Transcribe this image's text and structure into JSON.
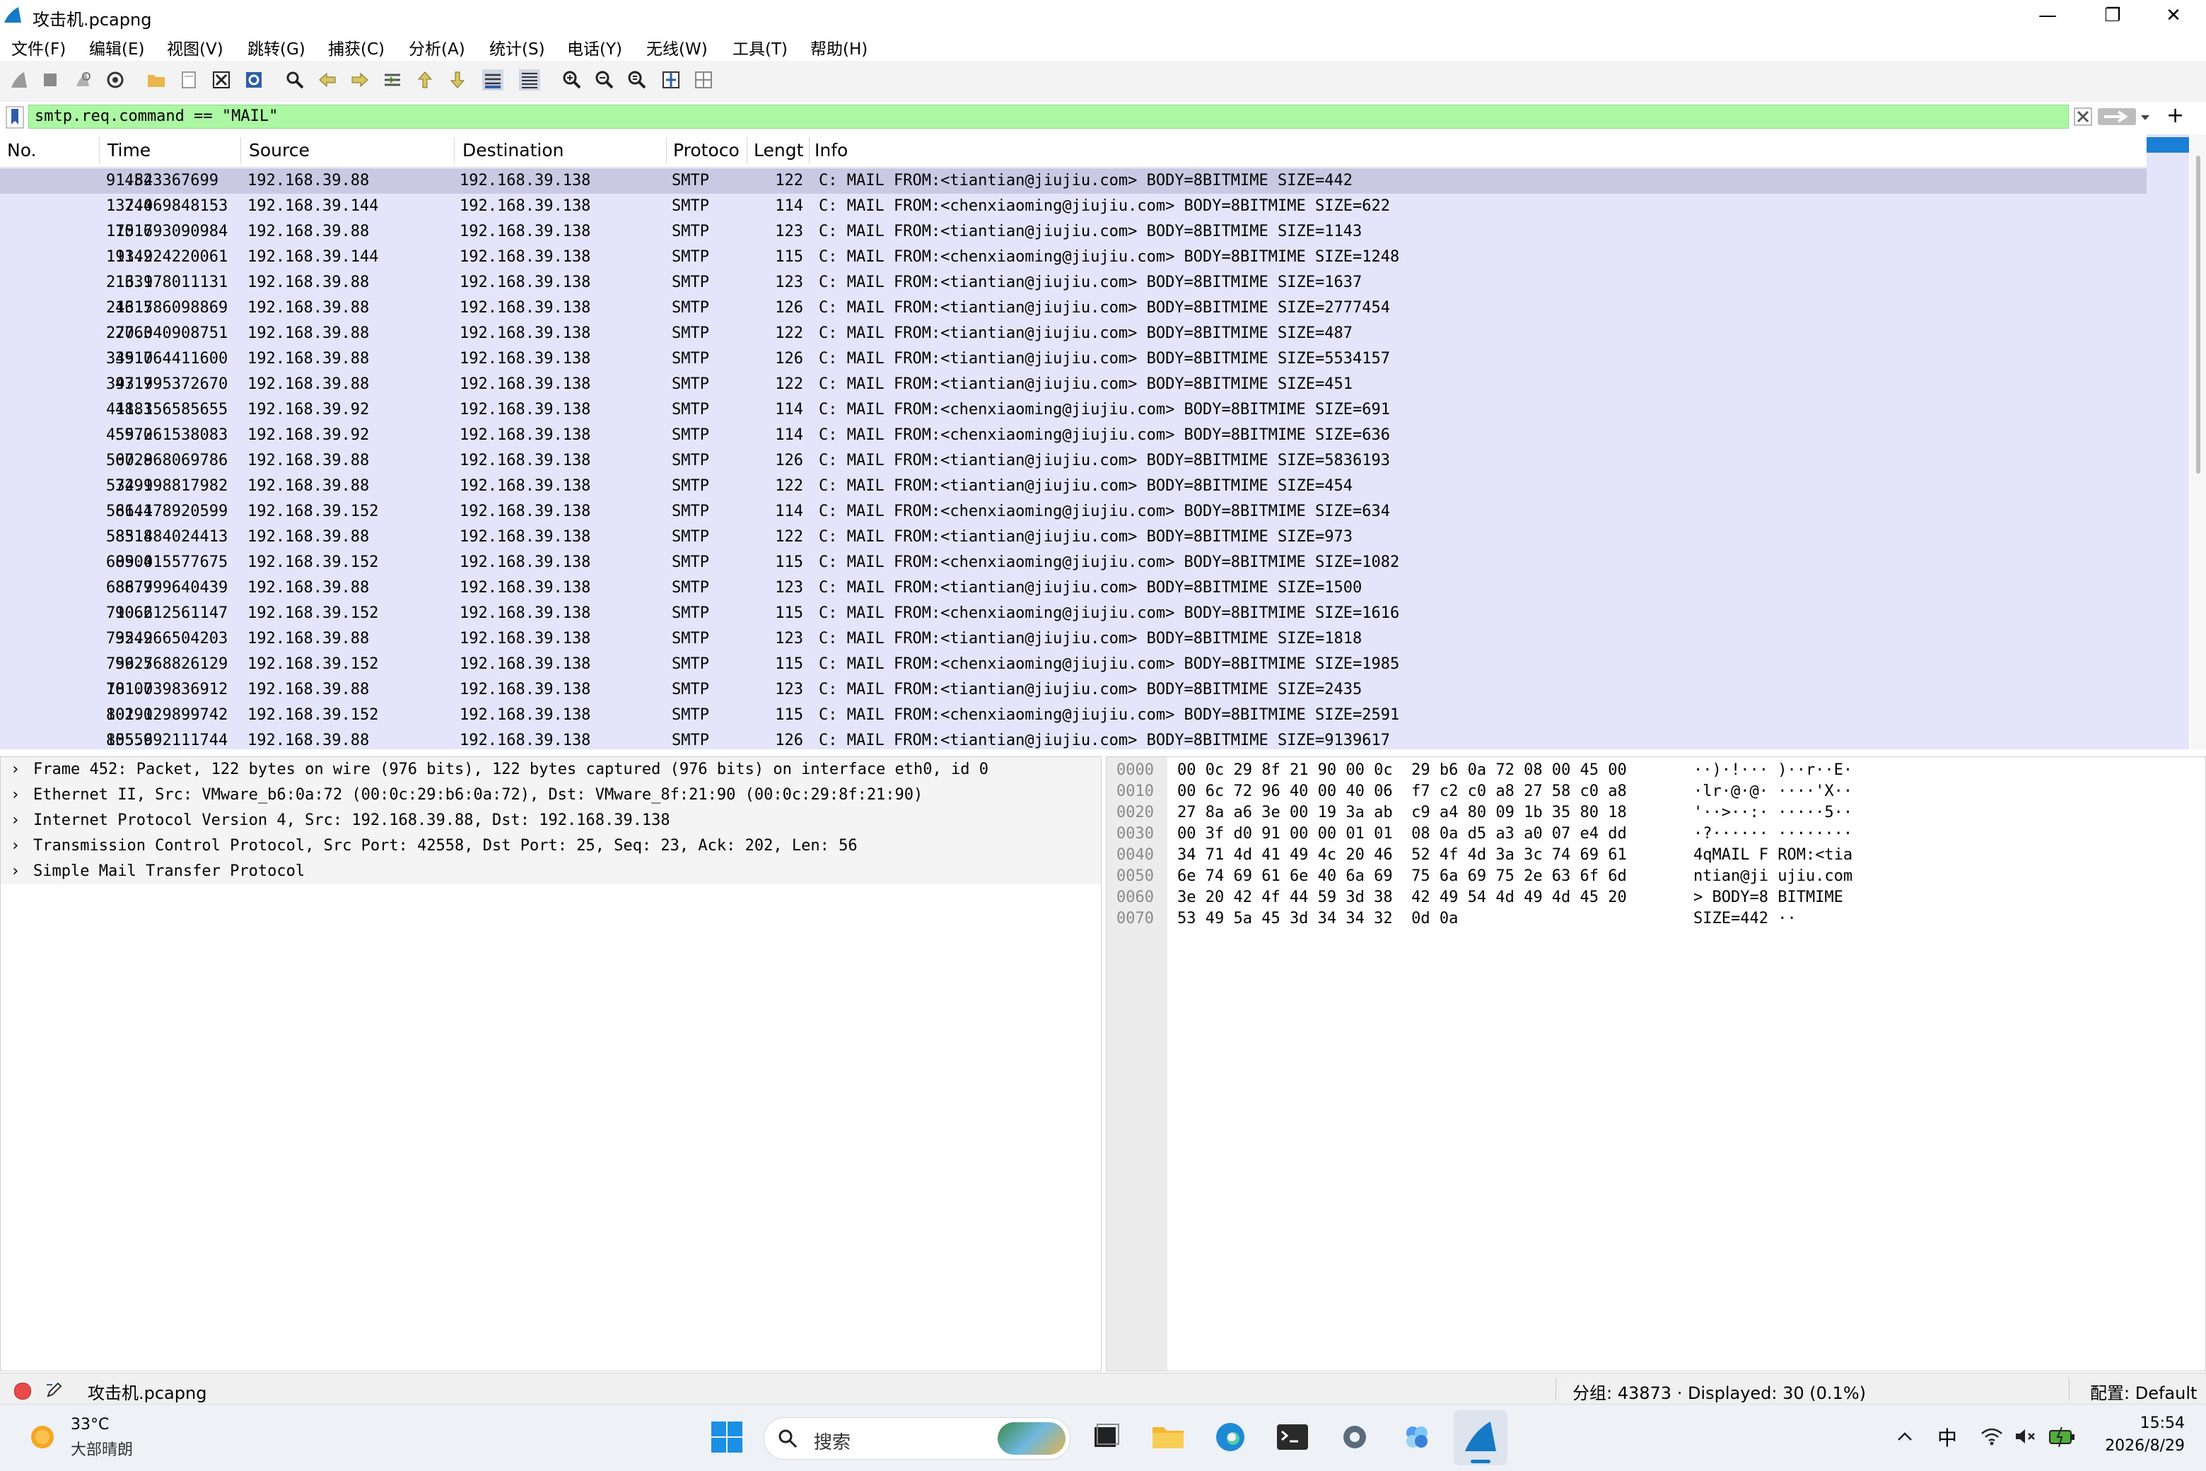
{
  "window": {
    "title": "攻击机.pcapng",
    "controls": {
      "minimize": "—",
      "restore": "❐",
      "close": "✕"
    }
  },
  "menu": [
    "文件(F)",
    "编辑(E)",
    "视图(V)",
    "跳转(G)",
    "捕获(C)",
    "分析(A)",
    "统计(S)",
    "电话(Y)",
    "无线(W)",
    "工具(T)",
    "帮助(H)"
  ],
  "filter": {
    "value": "smtp.req.command == \"MAIL\"",
    "add_label": "+"
  },
  "packet_list": {
    "columns": [
      "No.",
      "Time",
      "Source",
      "Destination",
      "Protoco",
      "Lengt",
      "Info"
    ],
    "rows": [
      {
        "no": "452",
        "time": "91.843367699",
        "src": "192.168.39.88",
        "dst": "192.168.39.138",
        "proto": "SMTP",
        "len": "122",
        "info": "C: MAIL FROM:<tiantian@jiujiu.com> BODY=8BITMIME SIZE=442"
      },
      {
        "no": "744",
        "time": "132.069848153",
        "src": "192.168.39.144",
        "dst": "192.168.39.138",
        "proto": "SMTP",
        "len": "114",
        "info": "C: MAIL FROM:<chenxiaoming@jiujiu.com> BODY=8BITMIME SIZE=622"
      },
      {
        "no": "1016",
        "time": "175.793090984",
        "src": "192.168.39.88",
        "dst": "192.168.39.138",
        "proto": "SMTP",
        "len": "123",
        "info": "C: MAIL FROM:<tiantian@jiujiu.com> BODY=8BITMIME SIZE=1143"
      },
      {
        "no": "1142",
        "time": "193.924220061",
        "src": "192.168.39.144",
        "dst": "192.168.39.138",
        "proto": "SMTP",
        "len": "115",
        "info": "C: MAIL FROM:<chenxiaoming@jiujiu.com> BODY=8BITMIME SIZE=1248"
      },
      {
        "no": "1331",
        "time": "216.978011131",
        "src": "192.168.39.88",
        "dst": "192.168.39.138",
        "proto": "SMTP",
        "len": "123",
        "info": "C: MAIL FROM:<tiantian@jiujiu.com> BODY=8BITMIME SIZE=1637"
      },
      {
        "no": "1615",
        "time": "243.786098869",
        "src": "192.168.39.88",
        "dst": "192.168.39.138",
        "proto": "SMTP",
        "len": "126",
        "info": "C: MAIL FROM:<tiantian@jiujiu.com> BODY=8BITMIME SIZE=2777454"
      },
      {
        "no": "2763",
        "time": "270.040908751",
        "src": "192.168.39.88",
        "dst": "192.168.39.138",
        "proto": "SMTP",
        "len": "122",
        "info": "C: MAIL FROM:<tiantian@jiujiu.com> BODY=8BITMIME SIZE=487"
      },
      {
        "no": "3917",
        "time": "345.064411600",
        "src": "192.168.39.88",
        "dst": "192.168.39.138",
        "proto": "SMTP",
        "len": "126",
        "info": "C: MAIL FROM:<tiantian@jiujiu.com> BODY=8BITMIME SIZE=5534157"
      },
      {
        "no": "4717",
        "time": "393.995372670",
        "src": "192.168.39.88",
        "dst": "192.168.39.138",
        "proto": "SMTP",
        "len": "122",
        "info": "C: MAIL FROM:<tiantian@jiujiu.com> BODY=8BITMIME SIZE=451"
      },
      {
        "no": "4883",
        "time": "411.156585655",
        "src": "192.168.39.92",
        "dst": "192.168.39.138",
        "proto": "SMTP",
        "len": "114",
        "info": "C: MAIL FROM:<chenxiaoming@jiujiu.com> BODY=8BITMIME SIZE=691"
      },
      {
        "no": "5970",
        "time": "455.261538083",
        "src": "192.168.39.92",
        "dst": "192.168.39.138",
        "proto": "SMTP",
        "len": "114",
        "info": "C: MAIL FROM:<chenxiaoming@jiujiu.com> BODY=8BITMIME SIZE=636"
      },
      {
        "no": "6728",
        "time": "500.968069786",
        "src": "192.168.39.88",
        "dst": "192.168.39.138",
        "proto": "SMTP",
        "len": "126",
        "info": "C: MAIL FROM:<tiantian@jiujiu.com> BODY=8BITMIME SIZE=5836193"
      },
      {
        "no": "7291",
        "time": "534.998817982",
        "src": "192.168.39.88",
        "dst": "192.168.39.138",
        "proto": "SMTP",
        "len": "122",
        "info": "C: MAIL FROM:<tiantian@jiujiu.com> BODY=8BITMIME SIZE=454"
      },
      {
        "no": "8144",
        "time": "566.178920599",
        "src": "192.168.39.152",
        "dst": "192.168.39.138",
        "proto": "SMTP",
        "len": "114",
        "info": "C: MAIL FROM:<chenxiaoming@jiujiu.com> BODY=8BITMIME SIZE=634"
      },
      {
        "no": "8318",
        "time": "585.484024413",
        "src": "192.168.39.88",
        "dst": "192.168.39.138",
        "proto": "SMTP",
        "len": "122",
        "info": "C: MAIL FROM:<tiantian@jiujiu.com> BODY=8BITMIME SIZE=973"
      },
      {
        "no": "8504",
        "time": "609.015577675",
        "src": "192.168.39.152",
        "dst": "192.168.39.138",
        "proto": "SMTP",
        "len": "115",
        "info": "C: MAIL FROM:<chenxiaoming@jiujiu.com> BODY=8BITMIME SIZE=1082"
      },
      {
        "no": "8879",
        "time": "686.799640439",
        "src": "192.168.39.88",
        "dst": "192.168.39.138",
        "proto": "SMTP",
        "len": "123",
        "info": "C: MAIL FROM:<tiantian@jiujiu.com> BODY=8BITMIME SIZE=1500"
      },
      {
        "no": "9062",
        "time": "710.612561147",
        "src": "192.168.39.152",
        "dst": "192.168.39.138",
        "proto": "SMTP",
        "len": "115",
        "info": "C: MAIL FROM:<chenxiaoming@jiujiu.com> BODY=8BITMIME SIZE=1616"
      },
      {
        "no": "9549",
        "time": "732.266504203",
        "src": "192.168.39.88",
        "dst": "192.168.39.138",
        "proto": "SMTP",
        "len": "123",
        "info": "C: MAIL FROM:<tiantian@jiujiu.com> BODY=8BITMIME SIZE=1818"
      },
      {
        "no": "9925",
        "time": "756.768826129",
        "src": "192.168.39.152",
        "dst": "192.168.39.138",
        "proto": "SMTP",
        "len": "115",
        "info": "C: MAIL FROM:<chenxiaoming@jiujiu.com> BODY=8BITMIME SIZE=1985"
      },
      {
        "no": "10107",
        "time": "781.039836912",
        "src": "192.168.39.88",
        "dst": "192.168.39.138",
        "proto": "SMTP",
        "len": "123",
        "info": "C: MAIL FROM:<tiantian@jiujiu.com> BODY=8BITMIME SIZE=2435"
      },
      {
        "no": "10290",
        "time": "801.129899742",
        "src": "192.168.39.152",
        "dst": "192.168.39.138",
        "proto": "SMTP",
        "len": "115",
        "info": "C: MAIL FROM:<chenxiaoming@jiujiu.com> BODY=8BITMIME SIZE=2591"
      },
      {
        "no": "10559",
        "time": "855.692111744",
        "src": "192.168.39.88",
        "dst": "192.168.39.138",
        "proto": "SMTP",
        "len": "126",
        "info": "C: MAIL FROM:<tiantian@jiujiu.com> BODY=8BITMIME SIZE=9139617"
      }
    ]
  },
  "details": [
    "Frame 452: Packet, 122 bytes on wire (976 bits), 122 bytes captured (976 bits) on interface eth0, id 0",
    "Ethernet II, Src: VMware_b6:0a:72 (00:0c:29:b6:0a:72), Dst: VMware_8f:21:90 (00:0c:29:8f:21:90)",
    "Internet Protocol Version 4, Src: 192.168.39.88, Dst: 192.168.39.138",
    "Transmission Control Protocol, Src Port: 42558, Dst Port: 25, Seq: 23, Ack: 202, Len: 56",
    "Simple Mail Transfer Protocol"
  ],
  "bytes": [
    {
      "off": "0000",
      "hex": "00 0c 29 8f 21 90 00 0c  29 b6 0a 72 08 00 45 00",
      "ascii": "··)·!··· )··r··E·"
    },
    {
      "off": "0010",
      "hex": "00 6c 72 96 40 00 40 06  f7 c2 c0 a8 27 58 c0 a8",
      "ascii": "·lr·@·@· ····'X··"
    },
    {
      "off": "0020",
      "hex": "27 8a a6 3e 00 19 3a ab  c9 a4 80 09 1b 35 80 18",
      "ascii": "'··>··:· ·····5··"
    },
    {
      "off": "0030",
      "hex": "00 3f d0 91 00 00 01 01  08 0a d5 a3 a0 07 e4 dd",
      "ascii": "·?······ ········"
    },
    {
      "off": "0040",
      "hex": "34 71 4d 41 49 4c 20 46  52 4f 4d 3a 3c 74 69 61",
      "ascii": "4qMAIL F ROM:<tia"
    },
    {
      "off": "0050",
      "hex": "6e 74 69 61 6e 40 6a 69  75 6a 69 75 2e 63 6f 6d",
      "ascii": "ntian@ji ujiu.com"
    },
    {
      "off": "0060",
      "hex": "3e 20 42 4f 44 59 3d 38  42 49 54 4d 49 4d 45 20",
      "ascii": "> BODY=8 BITMIME "
    },
    {
      "off": "0070",
      "hex": "53 49 5a 45 3d 34 34 32  0d 0a",
      "ascii": "SIZE=442 ··"
    }
  ],
  "status": {
    "file": "攻击机.pcapng",
    "counts": "分组: 43873 · Displayed: 30 (0.1%)",
    "profile": "配置: Default"
  },
  "taskbar": {
    "weather_temp": "33°C",
    "weather_desc": "大部晴朗",
    "search_placeholder": "搜索",
    "ime": "中",
    "time": "15:54",
    "date": "2026/8/29"
  }
}
